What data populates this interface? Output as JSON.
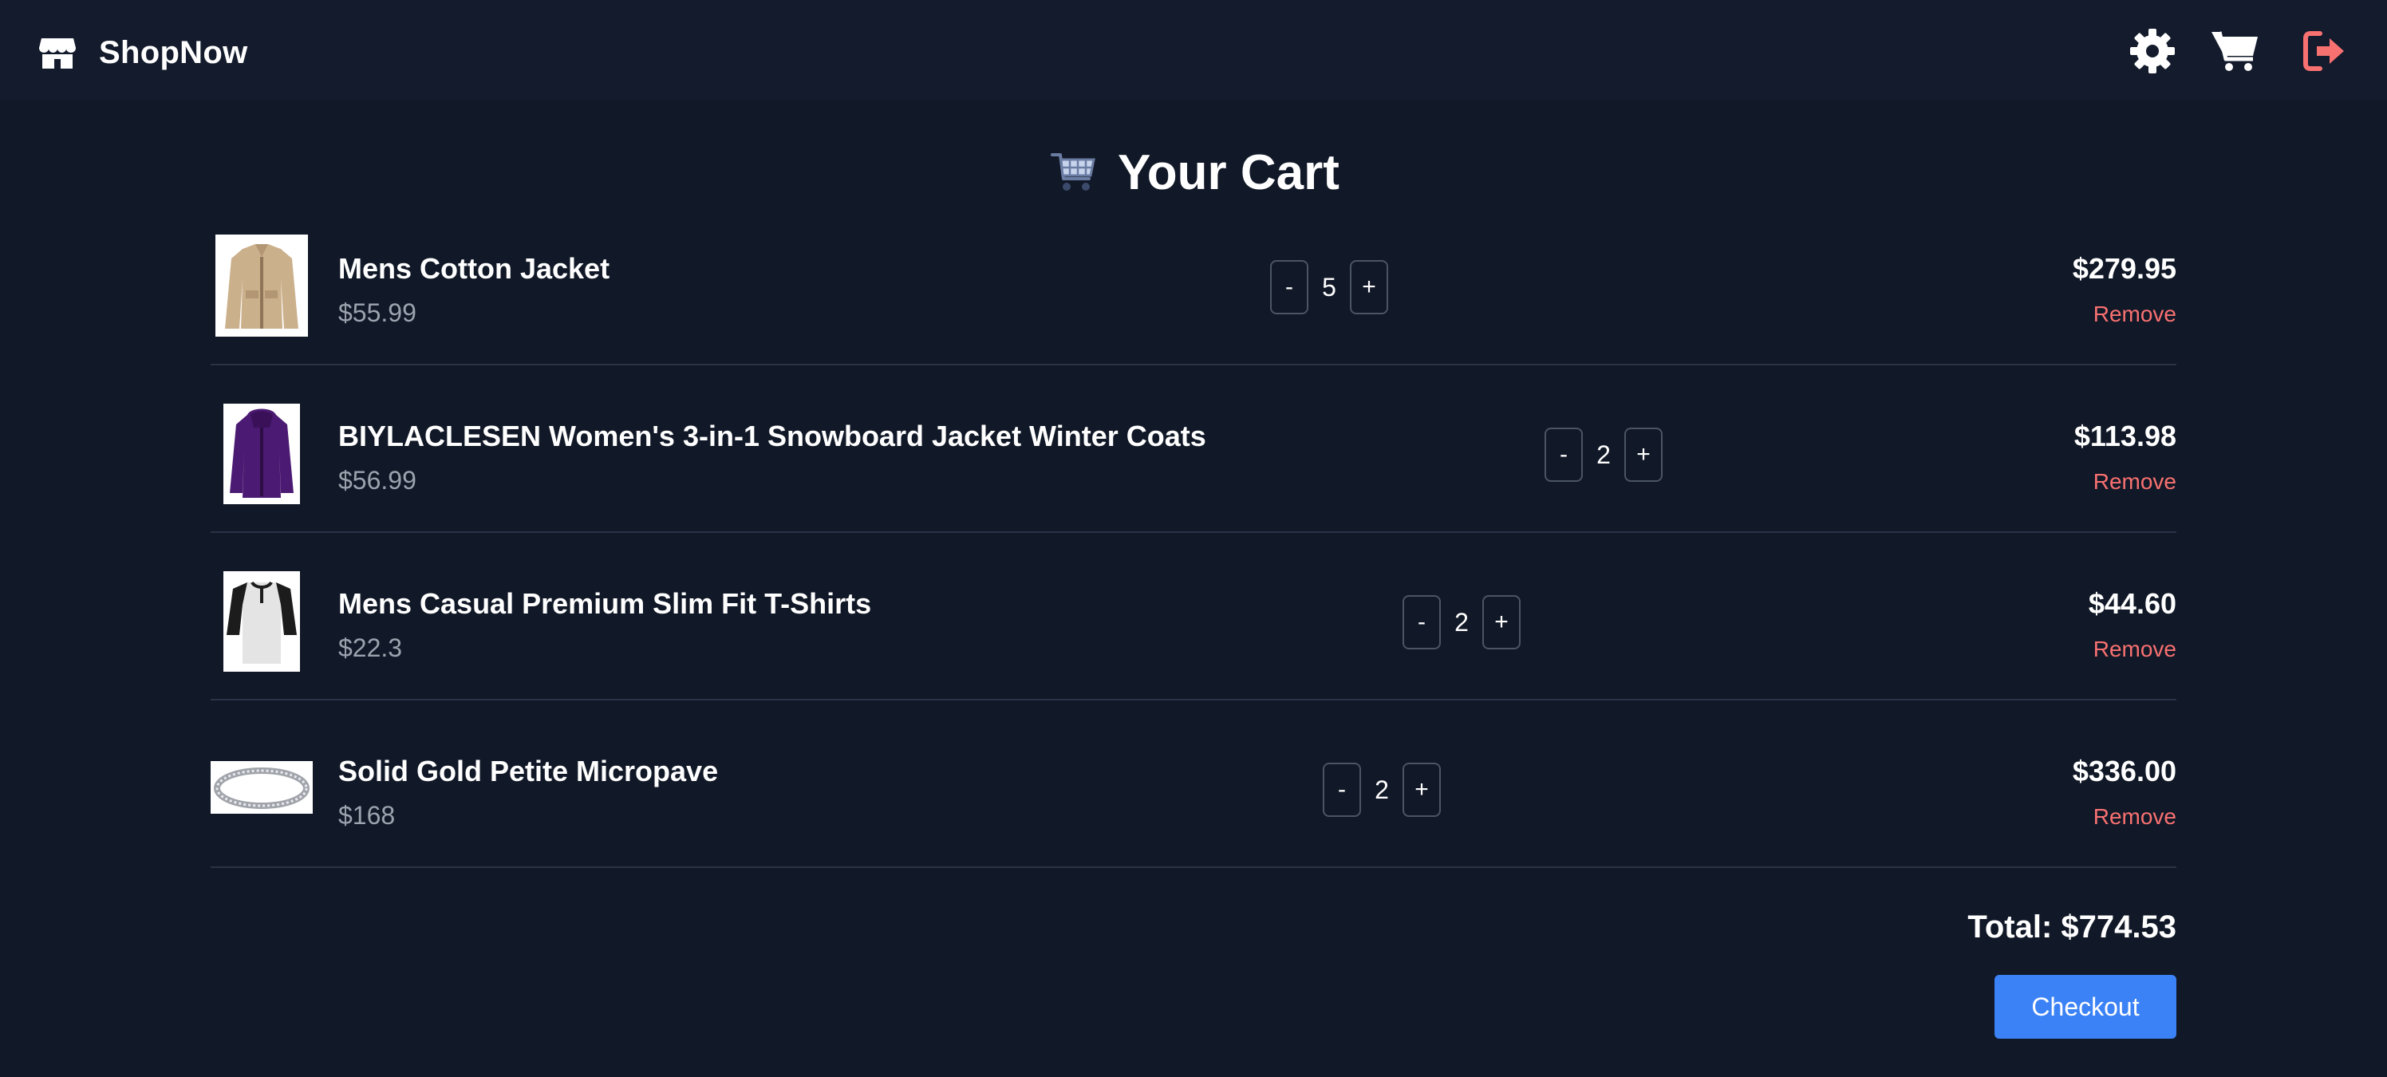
{
  "brand": {
    "name": "ShopNow",
    "icon": "store-icon"
  },
  "navbar": {
    "icons": [
      "gear-icon",
      "cart-icon",
      "logout-icon"
    ],
    "logout_color": "#f87171"
  },
  "page": {
    "title": "Your Cart",
    "title_icon": "shopping-cart-icon"
  },
  "cart": {
    "items": [
      {
        "name": "Mens Cotton Jacket",
        "unit_price": "$55.99",
        "quantity": "5",
        "line_total": "$279.95",
        "remove_label": "Remove",
        "decrement_label": "-",
        "increment_label": "+"
      },
      {
        "name": "BIYLACLESEN Women's 3-in-1 Snowboard Jacket Winter Coats",
        "unit_price": "$56.99",
        "quantity": "2",
        "line_total": "$113.98",
        "remove_label": "Remove",
        "decrement_label": "-",
        "increment_label": "+"
      },
      {
        "name": "Mens Casual Premium Slim Fit T-Shirts",
        "unit_price": "$22.3",
        "quantity": "2",
        "line_total": "$44.60",
        "remove_label": "Remove",
        "decrement_label": "-",
        "increment_label": "+"
      },
      {
        "name": "Solid Gold Petite Micropave",
        "unit_price": "$168",
        "quantity": "2",
        "line_total": "$336.00",
        "remove_label": "Remove",
        "decrement_label": "-",
        "increment_label": "+"
      }
    ],
    "total_label": "Total: $774.53",
    "checkout_label": "Checkout"
  },
  "colors": {
    "background": "#111827",
    "navbar": "#131b2c",
    "accent": "#3b82f6",
    "remove": "#f87171",
    "muted": "#9ca3af"
  }
}
